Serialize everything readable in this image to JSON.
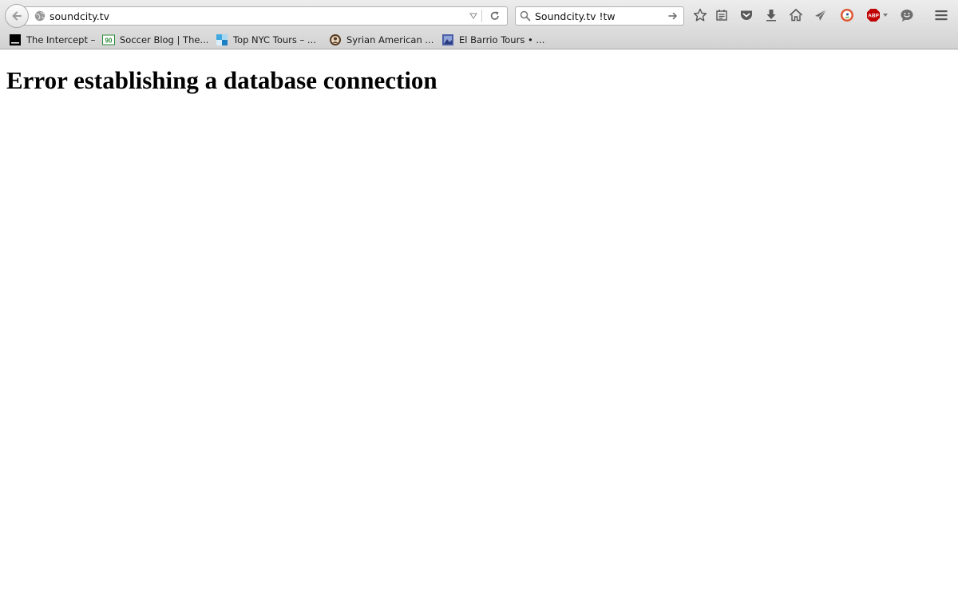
{
  "browser": {
    "url": "soundcity.tv",
    "search_query": "Soundcity.tv !tw",
    "abp_label": "ABP"
  },
  "bookmarks": [
    {
      "label": "The Intercept –",
      "icon": "intercept-favicon"
    },
    {
      "label": "Soccer Blog | The...",
      "icon": "soccer-blog-favicon",
      "icon_text": "90"
    },
    {
      "label": "Top NYC Tours – ...",
      "icon": "nyc-favicon"
    },
    {
      "label": "Syrian American ...",
      "icon": "syrian-american-favicon"
    },
    {
      "label": "El Barrio Tours • ...",
      "icon": "el-barrio-favicon"
    }
  ],
  "page": {
    "heading": "Error establishing a database connection"
  },
  "colors": {
    "toolbar": "#e4e4e4",
    "abp_red": "#c00000",
    "duckduckgo_orange": "#de5833"
  }
}
